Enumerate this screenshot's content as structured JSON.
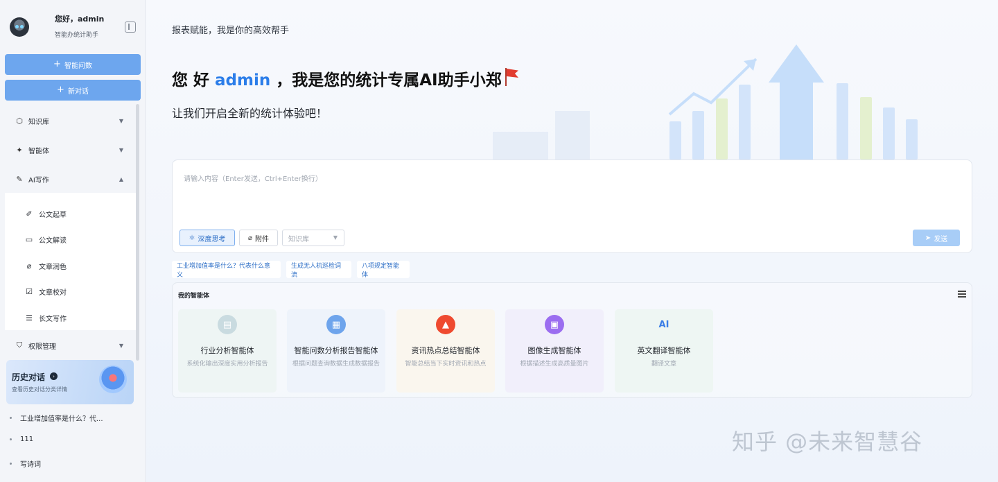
{
  "sidebar": {
    "greeting": "您好，admin",
    "subtitle": "智能办统计助手",
    "ask_button": "智能问数",
    "new_chat_button": "新对话",
    "plus": "+",
    "menu": [
      {
        "label": "知识库",
        "icon": "cube-icon",
        "expanded": false
      },
      {
        "label": "智能体",
        "icon": "sparkle-icon",
        "expanded": false
      },
      {
        "label": "AI写作",
        "icon": "pen-icon",
        "expanded": true
      },
      {
        "label": "权限管理",
        "icon": "shield-icon",
        "expanded": false
      }
    ],
    "writing_items": [
      {
        "label": "公文起草",
        "icon": "edit-icon"
      },
      {
        "label": "公文解读",
        "icon": "book-icon"
      },
      {
        "label": "文章润色",
        "icon": "brush-icon"
      },
      {
        "label": "文章校对",
        "icon": "check-doc-icon"
      },
      {
        "label": "长文写作",
        "icon": "doc-icon"
      }
    ],
    "history_title": "历史对话",
    "history_subtitle": "查看历史对话分类详情",
    "history_items": [
      "工业增加值率是什么？代...",
      "111",
      "写诗词"
    ]
  },
  "main": {
    "tagline": "报表赋能，我是你的高效帮手",
    "headline_prefix": "您 好 ",
    "headline_name": "admin",
    "headline_suffix": " ，我是您的统计专属AI助手小郑",
    "sub_headline": "让我们开启全新的统计体验吧！",
    "input": {
      "placeholder": "请输入内容（Enter发送，Ctrl+Enter换行）",
      "value": "",
      "deep_think": "深度思考",
      "attach": "附件",
      "kb_placeholder": "知识库",
      "send": "发送"
    },
    "suggestions": [
      "工业增加值率是什么？代表什么意义",
      "生成无人机巡检词流",
      "八项规定智能体"
    ],
    "agents_title": "我的智能体",
    "agents": [
      {
        "name": "行业分析智能体",
        "desc": "系统化输出深度实用分析报告",
        "icon": "chart-card-icon",
        "glyph": "▤",
        "bg": "#eef5f4",
        "icon_bg": "#c9dbe0"
      },
      {
        "name": "智能问数分析报告智能体",
        "desc": "根据问题查询数据生成数据报告",
        "icon": "report-icon",
        "glyph": "▦",
        "bg": "#eef3fb",
        "icon_bg": "#6ea4ec"
      },
      {
        "name": "资讯热点总结智能体",
        "desc": "智能总结当下实时资讯和热点",
        "icon": "fire-icon",
        "glyph": "▲",
        "bg": "#faf6ee",
        "icon_bg": "#ef4a2f"
      },
      {
        "name": "图像生成智能体",
        "desc": "根据描述生成高质量图片",
        "icon": "image-icon",
        "glyph": "▣",
        "bg": "#f1effb",
        "icon_bg": "#9b6df0"
      },
      {
        "name": "英文翻译智能体",
        "desc": "翻译文章",
        "icon": "ai-translate-icon",
        "glyph": "AI",
        "bg": "#eef6f3",
        "icon_bg": "transparent"
      }
    ],
    "watermark": "知乎 @未来智慧谷"
  }
}
